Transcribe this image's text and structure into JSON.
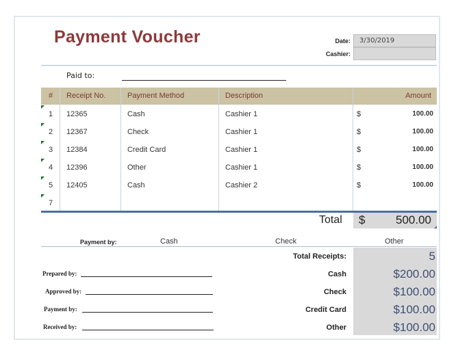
{
  "title": "Payment Voucher",
  "date_label": "Date:",
  "date_value": "3/30/2019",
  "cashier_label": "Cashier:",
  "cashier_value": "",
  "paid_to_label": "Paid to:",
  "columns": [
    "#",
    "Receipt No.",
    "Payment Method",
    "Description",
    "Amount"
  ],
  "rows": [
    {
      "num": "1",
      "receipt": "12365",
      "method": "Cash",
      "desc": "Cashier 1",
      "cur": "$",
      "amount": "100.00"
    },
    {
      "num": "2",
      "receipt": "12367",
      "method": "Check",
      "desc": "Cashier 1",
      "cur": "$",
      "amount": "100.00"
    },
    {
      "num": "3",
      "receipt": "12384",
      "method": "Credit Card",
      "desc": "Cashier 1",
      "cur": "$",
      "amount": "100.00"
    },
    {
      "num": "4",
      "receipt": "12396",
      "method": "Other",
      "desc": "Cashier 1",
      "cur": "$",
      "amount": "100.00"
    },
    {
      "num": "5",
      "receipt": "12405",
      "method": "Cash",
      "desc": "Cashier 2",
      "cur": "$",
      "amount": "100.00"
    },
    {
      "num": "7",
      "receipt": "",
      "method": "",
      "desc": "",
      "cur": "",
      "amount": ""
    }
  ],
  "total_label": "Total",
  "total_currency": "$",
  "total_value": "500.00",
  "payment_by_label": "Payment by:",
  "payment_options": [
    "Cash",
    "Check",
    "Other"
  ],
  "summary": {
    "total_receipts_label": "Total Receipts:",
    "total_receipts_value": "5",
    "items": [
      {
        "label": "Cash",
        "value": "$200.00"
      },
      {
        "label": "Check",
        "value": "$100.00"
      },
      {
        "label": "Credit Card",
        "value": "$100.00"
      },
      {
        "label": "Other",
        "value": "$100.00"
      }
    ]
  },
  "signatures": [
    "Prepared by:",
    "Approved by:",
    "Payment by:",
    "Received by:"
  ],
  "colors": {
    "title": "#8b3a3a",
    "header_bg": "#cbc3a4",
    "header_text": "#7a3b2e",
    "accent_line": "#4a6fa5",
    "shade": "#d9d9d9",
    "value_text": "#3e4f73",
    "marker": "#1e6e2a"
  }
}
